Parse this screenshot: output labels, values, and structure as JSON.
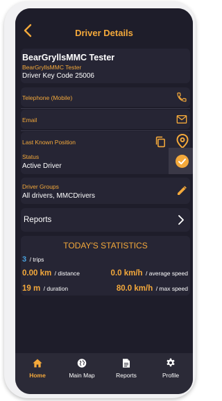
{
  "header": {
    "title": "Driver Details"
  },
  "driver": {
    "name": "BearGryllsMMC Tester",
    "org": "BearGryllsMMC Tester",
    "key_code": "Driver Key Code 25006"
  },
  "fields": {
    "telephone_label": "Telephone (Mobile)",
    "email_label": "Email",
    "position_label": "Last Known Position",
    "status_label": "Status",
    "status_value": "Active Driver",
    "groups_label": "Driver Groups",
    "groups_value": "All drivers, MMCDrivers"
  },
  "reports": {
    "label": "Reports"
  },
  "stats": {
    "title": "TODAY'S STATISTICS",
    "trips_value": "3",
    "trips_label": "/ trips",
    "distance_value": "0.00 km",
    "distance_label": "/ distance",
    "avg_speed_value": "0.0 km/h",
    "avg_speed_label": "/ average speed",
    "duration_value": "19 m",
    "duration_label": "/ duration",
    "max_speed_value": "80.0 km/h",
    "max_speed_label": "/ max speed"
  },
  "nav": {
    "items": [
      {
        "label": "Home",
        "icon": "home-icon",
        "active": true
      },
      {
        "label": "Main Map",
        "icon": "globe-icon"
      },
      {
        "label": "Reports",
        "icon": "document-icon"
      },
      {
        "label": "Profile",
        "icon": "gear-icon"
      }
    ]
  },
  "colors": {
    "accent": "#f4a93b",
    "background": "#1e1d2a",
    "card": "#262534",
    "trips": "#4aa3df"
  }
}
